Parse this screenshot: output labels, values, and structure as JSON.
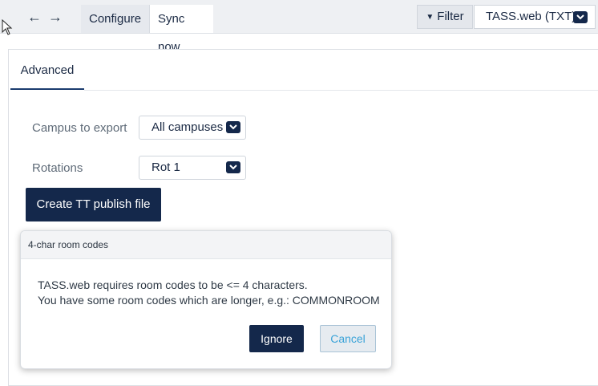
{
  "toolbar": {
    "back_icon": "arrow-left-icon",
    "forward_icon": "arrow-right-icon",
    "tabs": [
      {
        "label": "Configure",
        "active": false
      },
      {
        "label": "Sync now",
        "active": true
      }
    ],
    "filter_label": "Filter",
    "format_select_value": "TASS.web (TXT)"
  },
  "panel": {
    "tab_label": "Advanced",
    "fields": {
      "campus_label": "Campus to export",
      "campus_value": "All campuses",
      "rotations_label": "Rotations",
      "rotations_value": "Rot 1"
    },
    "publish_button": "Create TT publish file"
  },
  "dialog": {
    "title": "4-char room codes",
    "line1": "TASS.web requires room codes to be <= 4 characters.",
    "line2": "You have some room codes which are longer, e.g.: COMMONROOM",
    "ignore_label": "Ignore",
    "cancel_label": "Cancel"
  },
  "colors": {
    "primary": "#14284b",
    "cancel_text": "#3aa3d8",
    "toolbar_bg": "#eef0f3"
  }
}
